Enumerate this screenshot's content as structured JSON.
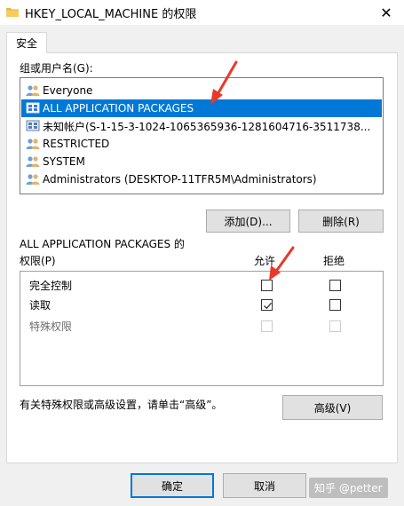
{
  "window": {
    "title": "HKEY_LOCAL_MACHINE 的权限",
    "close_glyph": "✕"
  },
  "tabs": [
    {
      "label": "安全",
      "selected": true
    }
  ],
  "principals": {
    "label": "组或用户名(G):",
    "items": [
      {
        "name": "Everyone",
        "icon": "users-icon",
        "selected": false
      },
      {
        "name": "ALL APPLICATION PACKAGES",
        "icon": "package-icon",
        "selected": true
      },
      {
        "name": "未知帐户(S-1-15-3-1024-1065365936-1281604716-3511738...",
        "icon": "unknown-account-icon",
        "selected": false
      },
      {
        "name": "RESTRICTED",
        "icon": "users-icon",
        "selected": false
      },
      {
        "name": "SYSTEM",
        "icon": "users-icon",
        "selected": false
      },
      {
        "name": "Administrators (DESKTOP-11TFR5M\\Administrators)",
        "icon": "users-icon",
        "selected": false
      }
    ]
  },
  "actions": {
    "add_label": "添加(D)...",
    "remove_label": "删除(R)"
  },
  "permissions": {
    "heading_line1": "ALL APPLICATION PACKAGES 的",
    "heading_line2": "权限(P)",
    "allow_label": "允许",
    "deny_label": "拒绝",
    "rows": [
      {
        "name": "完全控制",
        "allow": false,
        "deny": false,
        "disabled": false
      },
      {
        "name": "读取",
        "allow": true,
        "deny": false,
        "disabled": false
      },
      {
        "name": "特殊权限",
        "allow": false,
        "deny": false,
        "disabled": true
      }
    ]
  },
  "advanced": {
    "note": "有关特殊权限或高级设置，请单击“高级”。",
    "button_label": "高级(V)"
  },
  "footer": {
    "ok_label": "确定",
    "cancel_label": "取消",
    "watermark": "知乎 @petter"
  },
  "colors": {
    "selection": "#0078d7",
    "annotation_arrow": "#e8392b"
  }
}
